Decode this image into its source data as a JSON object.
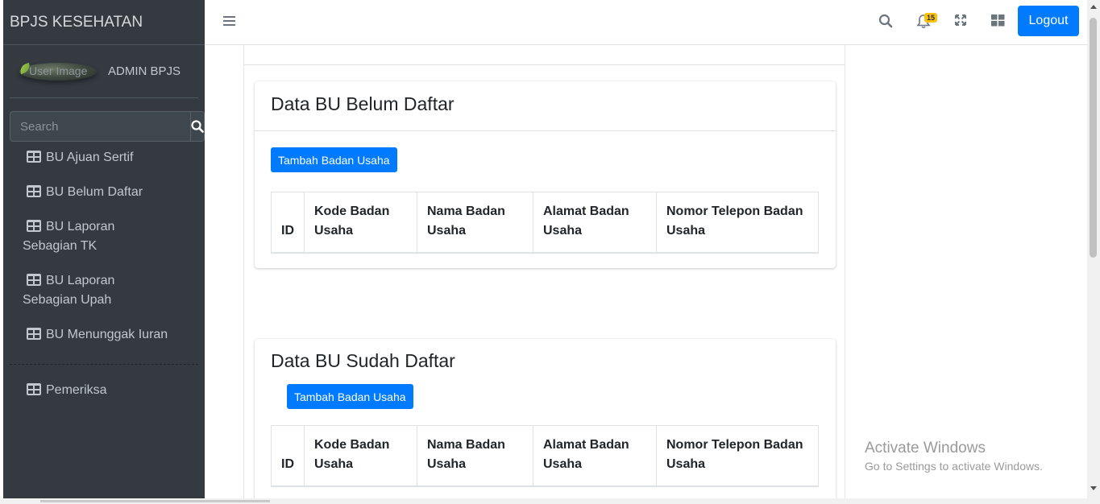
{
  "sidebar": {
    "brand": "BPJS KESEHATAN",
    "user_image_alt": "User Image",
    "user_name": "ADMIN BPJS",
    "search_placeholder": "Search",
    "items": [
      {
        "label": "BU Ajuan Sertif",
        "icon": "table-icon"
      },
      {
        "label": "BU Belum Daftar",
        "icon": "table-icon"
      },
      {
        "label": "BU Laporan Sebagian TK",
        "icon": "table-icon"
      },
      {
        "label": "BU Laporan Sebagian Upah",
        "icon": "table-icon"
      },
      {
        "label": "BU Menunggak Iuran",
        "icon": "table-icon"
      }
    ],
    "items_secondary": [
      {
        "label": "Pemeriksa",
        "icon": "table-icon"
      }
    ]
  },
  "topbar": {
    "notification_count": "15",
    "logout_label": "Logout",
    "icons": [
      "menu-icon",
      "search-icon",
      "bell-icon",
      "expand-icon",
      "grid-icon"
    ],
    "accent": "#007bff",
    "badge_color": "#ffc107"
  },
  "main": {
    "card1": {
      "title": "Data BU Belum Daftar",
      "add_button": "Tambah Badan Usaha",
      "columns": [
        "ID",
        "Kode Badan Usaha",
        "Nama Badan Usaha",
        "Alamat Badan Usaha",
        "Nomor Telepon Badan Usaha"
      ]
    },
    "card2": {
      "title": "Data BU Sudah Daftar",
      "add_button": "Tambah Badan Usaha",
      "columns": [
        "ID",
        "Kode Badan Usaha",
        "Nama Badan Usaha",
        "Alamat Badan Usaha",
        "Nomor Telepon Badan Usaha"
      ]
    }
  },
  "watermark": {
    "line1": "Activate Windows",
    "line2": "Go to Settings to activate Windows."
  }
}
